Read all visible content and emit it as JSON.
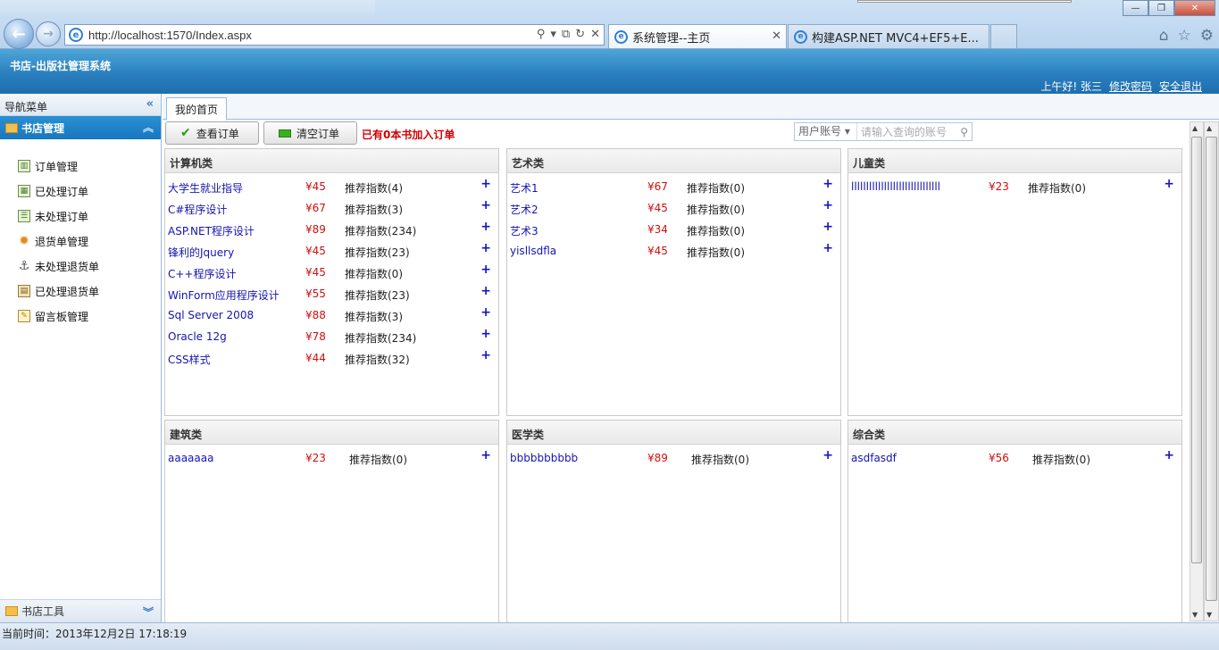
{
  "browser": {
    "url": "http://localhost:1570/Index.aspx",
    "tabs": [
      {
        "label": "系统管理--主页"
      },
      {
        "label": "构建ASP.NET MVC4+EF5+E..."
      }
    ]
  },
  "app": {
    "title": "书店-出版社管理系统",
    "greeting": "上午好! 张三",
    "change_password": "修改密码",
    "logout": "安全退出"
  },
  "sidebar": {
    "header": "导航菜单",
    "panel": "书店管理",
    "items": [
      {
        "label": "订单管理",
        "icon": "table-icon"
      },
      {
        "label": "已处理订单",
        "icon": "grid-icon"
      },
      {
        "label": "未处理订单",
        "icon": "list-icon"
      },
      {
        "label": "退货单管理",
        "icon": "gear-icon"
      },
      {
        "label": "未处理退货单",
        "icon": "anchor-icon"
      },
      {
        "label": "已处理退货单",
        "icon": "document-icon"
      },
      {
        "label": "留言板管理",
        "icon": "edit-icon"
      }
    ],
    "footer": "书店工具"
  },
  "main": {
    "home_tab": "我的首页",
    "view_order": "查看订单",
    "clear_order": "清空订单",
    "order_message": "已有0本书加入订单",
    "search_select": "用户账号",
    "search_placeholder": "请输入查询的账号"
  },
  "categories": [
    {
      "name": "计算机类",
      "books": [
        {
          "title": "大学生就业指导",
          "price": "¥45",
          "rec": "推荐指数(4)"
        },
        {
          "title": "C#程序设计",
          "price": "¥67",
          "rec": "推荐指数(3)"
        },
        {
          "title": "ASP.NET程序设计",
          "price": "¥89",
          "rec": "推荐指数(234)"
        },
        {
          "title": "锋利的Jquery",
          "price": "¥45",
          "rec": "推荐指数(23)"
        },
        {
          "title": "C++程序设计",
          "price": "¥45",
          "rec": "推荐指数(0)"
        },
        {
          "title": "WinForm应用程序设计",
          "price": "¥55",
          "rec": "推荐指数(23)"
        },
        {
          "title": "Sql Server 2008",
          "price": "¥88",
          "rec": "推荐指数(3)"
        },
        {
          "title": "Oracle 12g",
          "price": "¥78",
          "rec": "推荐指数(234)"
        },
        {
          "title": "CSS样式",
          "price": "¥44",
          "rec": "推荐指数(32)"
        }
      ]
    },
    {
      "name": "艺术类",
      "books": [
        {
          "title": "艺术1",
          "price": "¥67",
          "rec": "推荐指数(0)"
        },
        {
          "title": "艺术2",
          "price": "¥45",
          "rec": "推荐指数(0)"
        },
        {
          "title": "艺术3",
          "price": "¥34",
          "rec": "推荐指数(0)"
        },
        {
          "title": "yisllsdfla",
          "price": "¥45",
          "rec": "推荐指数(0)"
        }
      ]
    },
    {
      "name": "儿童类",
      "books": [
        {
          "title": "llllllllllllllllllllllllllllll",
          "price": "¥23",
          "rec": "推荐指数(0)"
        }
      ]
    },
    {
      "name": "建筑类",
      "books": [
        {
          "title": "aaaaaaa",
          "price": "¥23",
          "rec": "推荐指数(0)"
        }
      ]
    },
    {
      "name": "医学类",
      "books": [
        {
          "title": "bbbbbbbbbb",
          "price": "¥89",
          "rec": "推荐指数(0)"
        }
      ]
    },
    {
      "name": "综合类",
      "books": [
        {
          "title": "asdfasdf",
          "price": "¥56",
          "rec": "推荐指数(0)"
        }
      ]
    }
  ],
  "add_symbol": "+",
  "status": {
    "time": "当前时间：2013年12月2日 17:18:19"
  },
  "colors": {
    "header_blue": "#2a7fbf",
    "panel_blue": "#1777bf",
    "link_blue": "#1515b0",
    "price_red": "#cc1010",
    "alert_red": "#d40000"
  }
}
